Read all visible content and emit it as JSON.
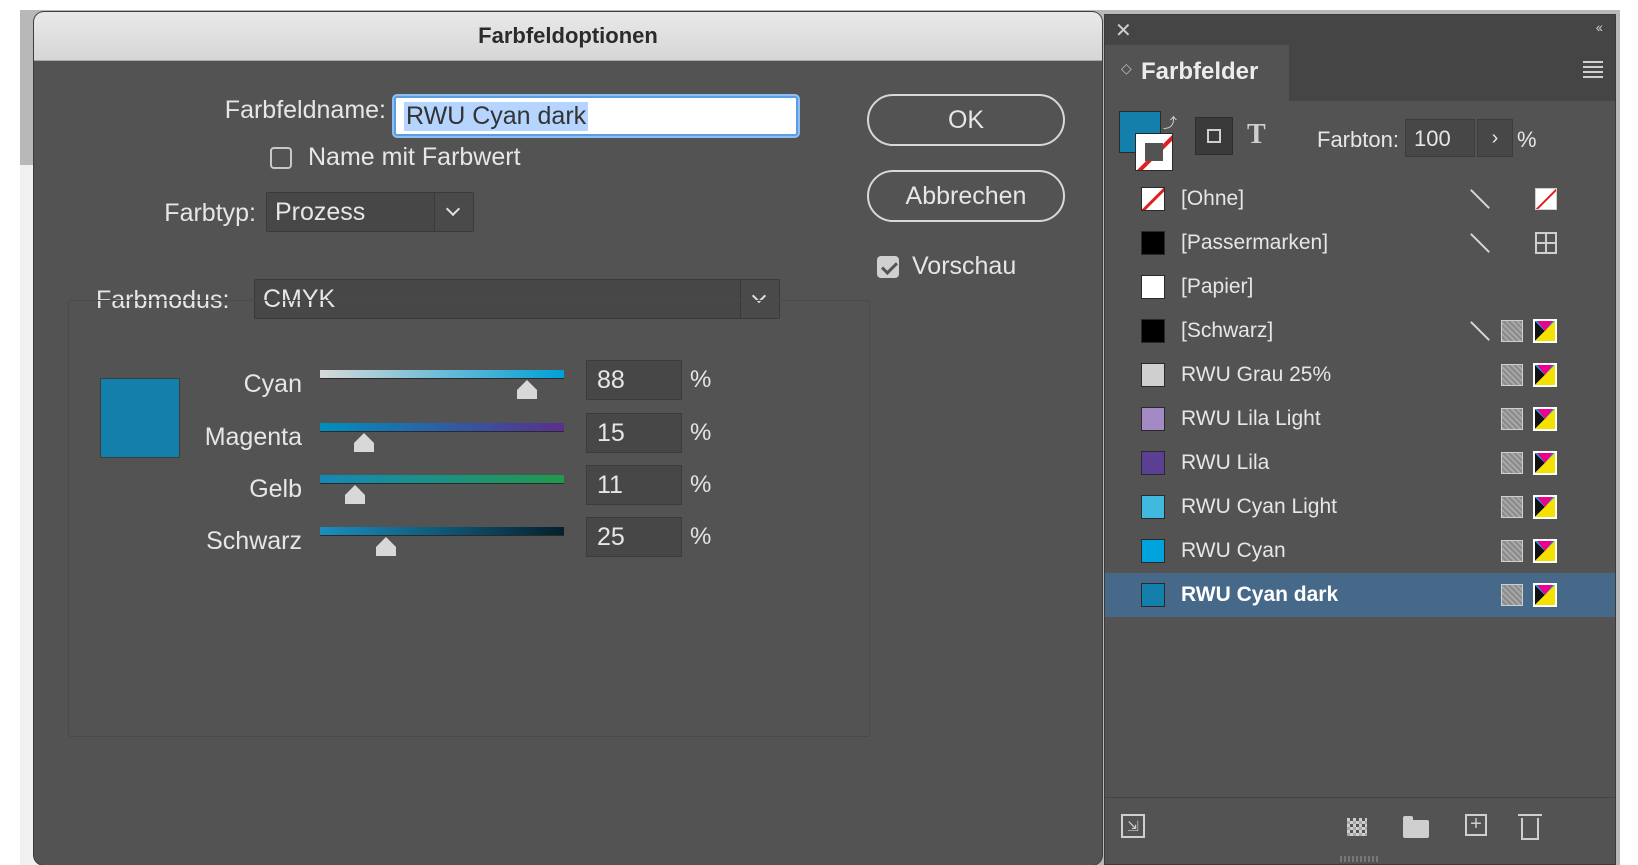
{
  "dialog": {
    "title": "Farbfeldoptionen",
    "name_label": "Farbfeldname:",
    "name_value": "RWU Cyan dark",
    "name_with_value_label": "Name mit Farbwert",
    "name_with_value_checked": false,
    "type_label": "Farbtyp:",
    "type_value": "Prozess",
    "mode_label": "Farbmodus:",
    "mode_value": "CMYK",
    "swatch_color": "#1280ab",
    "ok_label": "OK",
    "cancel_label": "Abbrechen",
    "preview_label": "Vorschau",
    "preview_checked": true,
    "sliders": [
      {
        "label": "Cyan",
        "value": "88",
        "unit": "%",
        "gradient": [
          "#d8d8d8",
          "#00a0d6"
        ]
      },
      {
        "label": "Magenta",
        "value": "15",
        "unit": "%",
        "gradient": [
          "#008fbf",
          "#5a2f8c"
        ]
      },
      {
        "label": "Gelb",
        "value": "11",
        "unit": "%",
        "gradient": [
          "#1688b8",
          "#1f9a4c"
        ]
      },
      {
        "label": "Schwarz",
        "value": "25",
        "unit": "%",
        "gradient": [
          "#1a8fc0",
          "#05202c"
        ]
      }
    ]
  },
  "panel": {
    "tab_label": "Farbfelder",
    "tint_label": "Farbton:",
    "tint_value": "100",
    "tint_unit": "%",
    "swatches": [
      {
        "name": "[Ohne]",
        "color": "none",
        "icons": [
          "no-edit-icon",
          "none-swatch-icon"
        ]
      },
      {
        "name": "[Passermarken]",
        "color": "#000000",
        "icons": [
          "no-edit-icon",
          "registration-icon"
        ]
      },
      {
        "name": "[Papier]",
        "color": "#ffffff",
        "icons": []
      },
      {
        "name": "[Schwarz]",
        "color": "#000000",
        "icons": [
          "no-edit-icon",
          "process-icon",
          "cmyk-icon"
        ]
      },
      {
        "name": "RWU Grau 25%",
        "color": "#cfcfcf",
        "icons": [
          "process-icon",
          "cmyk-icon"
        ]
      },
      {
        "name": "RWU Lila Light",
        "color": "#a38ac4",
        "icons": [
          "process-icon",
          "cmyk-icon"
        ]
      },
      {
        "name": "RWU Lila",
        "color": "#5a3f92",
        "icons": [
          "process-icon",
          "cmyk-icon"
        ]
      },
      {
        "name": "RWU Cyan Light",
        "color": "#3fb9dd",
        "icons": [
          "process-icon",
          "cmyk-icon"
        ]
      },
      {
        "name": "RWU Cyan",
        "color": "#00a3db",
        "icons": [
          "process-icon",
          "cmyk-icon"
        ]
      },
      {
        "name": "RWU Cyan dark",
        "color": "#1280ab",
        "icons": [
          "process-icon",
          "cmyk-icon"
        ],
        "selected": true
      }
    ]
  }
}
